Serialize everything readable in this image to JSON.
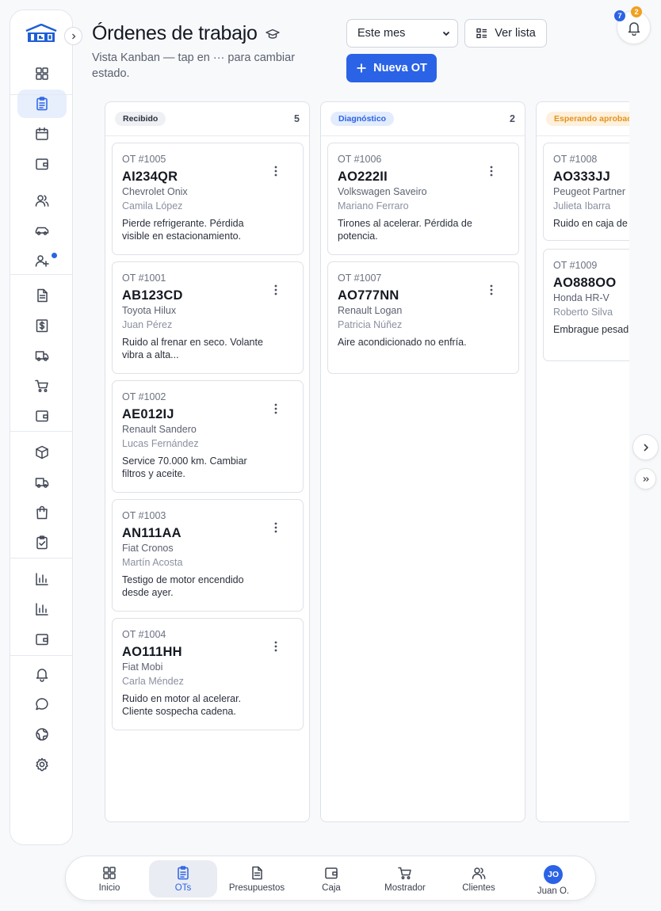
{
  "header": {
    "title": "Órdenes de trabajo",
    "subtitle": "Vista Kanban — tap en ··· para cambiar estado.",
    "period_value": "Este mes",
    "list_button": "Ver lista",
    "new_button": "Nueva OT",
    "notif_badge_blue": "7",
    "notif_badge_orange": "2"
  },
  "sidebar": {
    "items": [
      {
        "icon": "grid-icon"
      },
      {
        "icon": "clipboard-icon",
        "active": true
      },
      {
        "icon": "calendar-icon"
      },
      {
        "icon": "wallet-icon"
      },
      {
        "icon": "users-icon"
      },
      {
        "icon": "car-icon"
      },
      {
        "icon": "user-plus-icon",
        "dot": true
      },
      {
        "icon": "file-text-icon"
      },
      {
        "icon": "dollar-doc-icon"
      },
      {
        "icon": "truck-icon"
      },
      {
        "icon": "cart-icon"
      },
      {
        "icon": "wallet-icon"
      },
      {
        "icon": "box-icon"
      },
      {
        "icon": "truck-icon"
      },
      {
        "icon": "shopping-bag-icon"
      },
      {
        "icon": "clipboard-check-icon"
      },
      {
        "icon": "bar-chart-icon"
      },
      {
        "icon": "bar-chart-icon"
      },
      {
        "icon": "wallet-icon"
      },
      {
        "icon": "bell-icon"
      },
      {
        "icon": "chat-icon"
      },
      {
        "icon": "globe-icon"
      },
      {
        "icon": "settings-icon"
      }
    ]
  },
  "columns": [
    {
      "label": "Recibido",
      "count": "5",
      "chip_bg": "#eef0f4",
      "chip_color": "#2b303b",
      "cards": [
        {
          "id": "OT #1005",
          "plate": "AI234QR",
          "model": "Chevrolet Onix",
          "client": "Camila López",
          "desc": "Pierde refrigerante. Pérdida visible en estacionamiento."
        },
        {
          "id": "OT #1001",
          "plate": "AB123CD",
          "model": "Toyota Hilux",
          "client": "Juan Pérez",
          "desc": "Ruido al frenar en seco. Volante vibra a alta..."
        },
        {
          "id": "OT #1002",
          "plate": "AE012IJ",
          "model": "Renault Sandero",
          "client": "Lucas Fernández",
          "desc": "Service 70.000 km. Cambiar filtros y aceite."
        },
        {
          "id": "OT #1003",
          "plate": "AN111AA",
          "model": "Fiat Cronos",
          "client": "Martín Acosta",
          "desc": "Testigo de motor encendido desde ayer."
        },
        {
          "id": "OT #1004",
          "plate": "AO111HH",
          "model": "Fiat Mobi",
          "client": "Carla Méndez",
          "desc": "Ruido en motor al acelerar. Cliente sospecha cadena."
        }
      ]
    },
    {
      "label": "Diagnóstico",
      "count": "2",
      "chip_bg": "#e3ecfd",
      "chip_color": "#2b63e6",
      "cards": [
        {
          "id": "OT #1006",
          "plate": "AO222II",
          "model": "Volkswagen Saveiro",
          "client": "Mariano Ferraro",
          "desc": "Tirones al acelerar. Pérdida de potencia."
        },
        {
          "id": "OT #1007",
          "plate": "AO777NN",
          "model": "Renault Logan",
          "client": "Patricia Núñez",
          "desc": "Aire acondicionado no enfría."
        }
      ]
    },
    {
      "label": "Esperando aprobac",
      "count": "",
      "chip_bg": "#fdf0dc",
      "chip_color": "#e3941c",
      "cards": [
        {
          "id": "OT #1008",
          "plate": "AO333JJ",
          "model": "Peugeot Partner",
          "client": "Julieta Ibarra",
          "desc": "Ruido en caja de"
        },
        {
          "id": "OT #1009",
          "plate": "AO888OO",
          "model": "Honda HR-V",
          "client": "Roberto Silva",
          "desc": "Embrague pesad al acoplar."
        }
      ]
    }
  ],
  "bottom_nav": {
    "items": [
      {
        "label": "Inicio",
        "icon": "grid-icon"
      },
      {
        "label": "OTs",
        "icon": "clipboard-icon",
        "active": true
      },
      {
        "label": "Presupuestos",
        "icon": "file-text-icon"
      },
      {
        "label": "Caja",
        "icon": "wallet-icon"
      },
      {
        "label": "Mostrador",
        "icon": "cart-icon"
      },
      {
        "label": "Clientes",
        "icon": "users-icon"
      },
      {
        "label": "Juan O.",
        "icon": "avatar",
        "initials": "JO"
      }
    ]
  },
  "colors": {
    "accent": "#2b63e6",
    "warning": "#f0a020"
  }
}
